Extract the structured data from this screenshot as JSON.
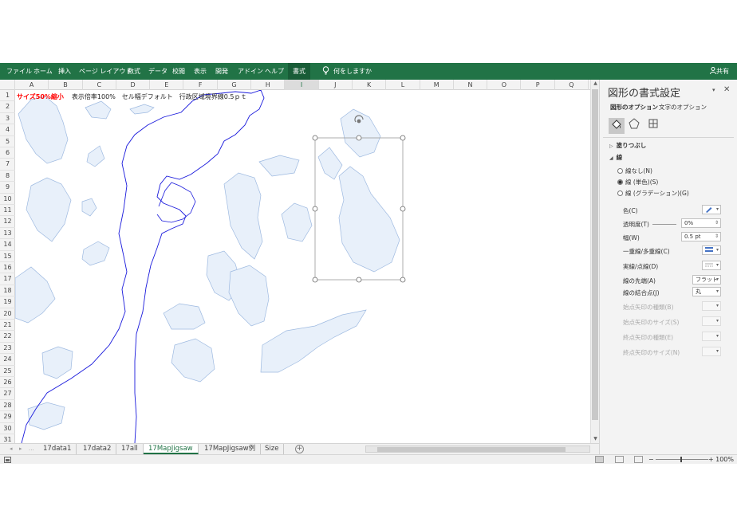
{
  "ribbon": {
    "tabs": [
      "ファイル",
      "ホーム",
      "挿入",
      "ページ レイアウト",
      "数式",
      "データ",
      "校閲",
      "表示",
      "開発",
      "アドイン",
      "ヘルプ",
      "書式"
    ],
    "active_tab": "書式",
    "tell_me": "何をしますか",
    "share": "共有"
  },
  "sheet": {
    "columns": [
      "A",
      "B",
      "C",
      "D",
      "E",
      "F",
      "G",
      "H",
      "I",
      "J",
      "K",
      "L",
      "M",
      "N",
      "O",
      "P",
      "Q"
    ],
    "selected_column": "I",
    "rows": [
      "1",
      "2",
      "3",
      "4",
      "5",
      "6",
      "7",
      "8",
      "9",
      "10",
      "11",
      "12",
      "13",
      "14",
      "15",
      "16",
      "17",
      "18",
      "19",
      "20",
      "21",
      "22",
      "23",
      "24",
      "25",
      "26",
      "27",
      "28",
      "29",
      "30",
      "31"
    ],
    "a1_red": "サイズ50%縮小",
    "a1_rest": "表示倍率100%　セル幅デフォルト　行政区域境界線0.5ｐｔ"
  },
  "sheet_tabs": {
    "tabs": [
      "17data1",
      "17data2",
      "17all",
      "17MapJigsaw",
      "17MapJigsaw例",
      "Size"
    ],
    "active": "17MapJigsaw",
    "nav_prev": "◂",
    "nav_next": "▸",
    "more": "...",
    "add": "+"
  },
  "status": {
    "zoom": "100%",
    "zoom_minus": "−",
    "zoom_plus": "+"
  },
  "pane": {
    "title": "図形の書式設定",
    "close": "✕",
    "dropdown": "▾",
    "subtabs": [
      "図形のオプション",
      "文字のオプション"
    ],
    "fill_section": "塗りつぶし",
    "line_section": "線",
    "radios": [
      "線なし(N)",
      "線 (単色)(S)",
      "線 (グラデーション)(G)"
    ],
    "selected_radio": "線 (単色)(S)",
    "props": [
      {
        "label": "色(C)",
        "value": "",
        "enabled": true
      },
      {
        "label": "透明度(T)",
        "value": "0%",
        "enabled": true
      },
      {
        "label": "幅(W)",
        "value": "0.5 pt",
        "enabled": true
      },
      {
        "label": "一重線/多重線(C)",
        "value": "",
        "enabled": true
      },
      {
        "label": "実線/点線(D)",
        "value": "",
        "enabled": true
      },
      {
        "label": "線の先端(A)",
        "value": "フラット",
        "enabled": true
      },
      {
        "label": "線の結合点(J)",
        "value": "丸",
        "enabled": true
      },
      {
        "label": "始点矢印の種類(B)",
        "value": "",
        "enabled": false
      },
      {
        "label": "始点矢印のサイズ(S)",
        "value": "",
        "enabled": false
      },
      {
        "label": "終点矢印の種類(E)",
        "value": "",
        "enabled": false
      },
      {
        "label": "終点矢印のサイズ(N)",
        "value": "",
        "enabled": false
      }
    ]
  },
  "colors": {
    "ribbon": "#217346",
    "shape_fill": "#e8f0fa",
    "shape_stroke": "#9db9e0",
    "boundary": "#1a1adc",
    "a1_red": "#ff0000"
  }
}
